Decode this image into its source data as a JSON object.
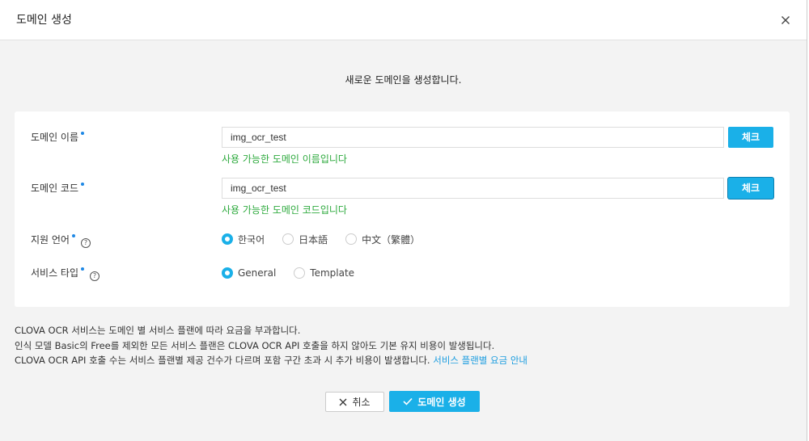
{
  "dialog": {
    "title": "도메인 생성",
    "intro": "새로운 도메인을 생성합니다."
  },
  "form": {
    "domain_name": {
      "label": "도메인 이름",
      "value": "img_ocr_test",
      "check_label": "체크",
      "status": "사용 가능한 도메인 이름입니다"
    },
    "domain_code": {
      "label": "도메인 코드",
      "value": "img_ocr_test",
      "check_label": "체크",
      "status": "사용 가능한 도메인 코드입니다"
    },
    "language": {
      "label": "지원 언어",
      "help": "?",
      "options": [
        "한국어",
        "日本語",
        "中文（繁體）"
      ],
      "selected": "한국어"
    },
    "service_type": {
      "label": "서비스 타입",
      "help": "?",
      "options": [
        "General",
        "Template"
      ],
      "selected": "General"
    }
  },
  "notice": {
    "line1": "CLOVA OCR 서비스는 도메인 별 서비스 플랜에 따라 요금을 부과합니다.",
    "line2": "인식 모델 Basic의 Free를 제외한 모든 서비스 플랜은 CLOVA OCR API 호출을 하지 않아도 기본 유지 비용이 발생됩니다.",
    "line3": "CLOVA OCR API 호출 수는 서비스 플랜별 제공 건수가 다르며 포함 구간 초과 시 추가 비용이 발생합니다.",
    "link": "서비스 플랜별 요금 안내"
  },
  "actions": {
    "cancel_label": "취소",
    "create_label": "도메인 생성"
  },
  "colors": {
    "primary": "#1ab0e8",
    "success": "#2eaa3e",
    "link": "#1e9ee0",
    "required_dot": "#1e88e5"
  }
}
